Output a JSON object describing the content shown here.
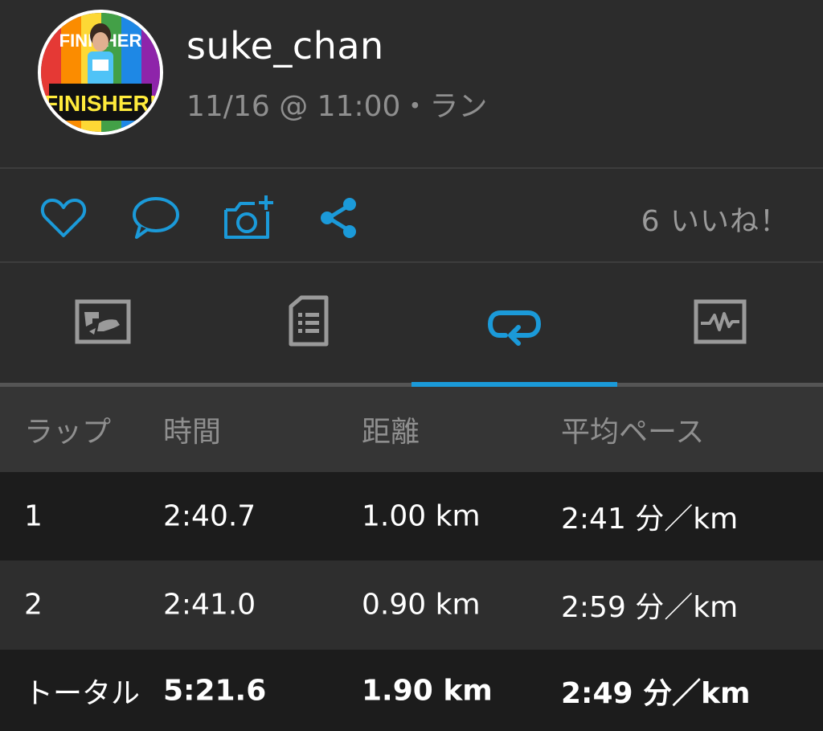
{
  "header": {
    "username": "suke_chan",
    "meta": "11/16 @ 11:00・ラン",
    "avatar_text_top": "FINISHER",
    "avatar_text_bottom": "FINISHER!"
  },
  "actions": {
    "icons": [
      "heart-icon",
      "comment-icon",
      "camera-add-icon",
      "share-icon"
    ],
    "likes": "6 いいね！",
    "accent": "#1b9ad9"
  },
  "tabs": [
    {
      "name": "map",
      "icon": "map-icon",
      "active": false
    },
    {
      "name": "details",
      "icon": "details-icon",
      "active": false
    },
    {
      "name": "laps",
      "icon": "laps-icon",
      "active": true
    },
    {
      "name": "charts",
      "icon": "chart-icon",
      "active": false
    }
  ],
  "laps_table": {
    "headers": [
      "ラップ",
      "時間",
      "距離",
      "平均ペース"
    ],
    "rows": [
      [
        "1",
        "2:40.7",
        "1.00 km",
        "2:41 分／km"
      ],
      [
        "2",
        "2:41.0",
        "0.90 km",
        "2:59 分／km"
      ]
    ],
    "total": [
      "トータル",
      "5:21.6",
      "1.90 km",
      "2:49 分／km"
    ]
  }
}
